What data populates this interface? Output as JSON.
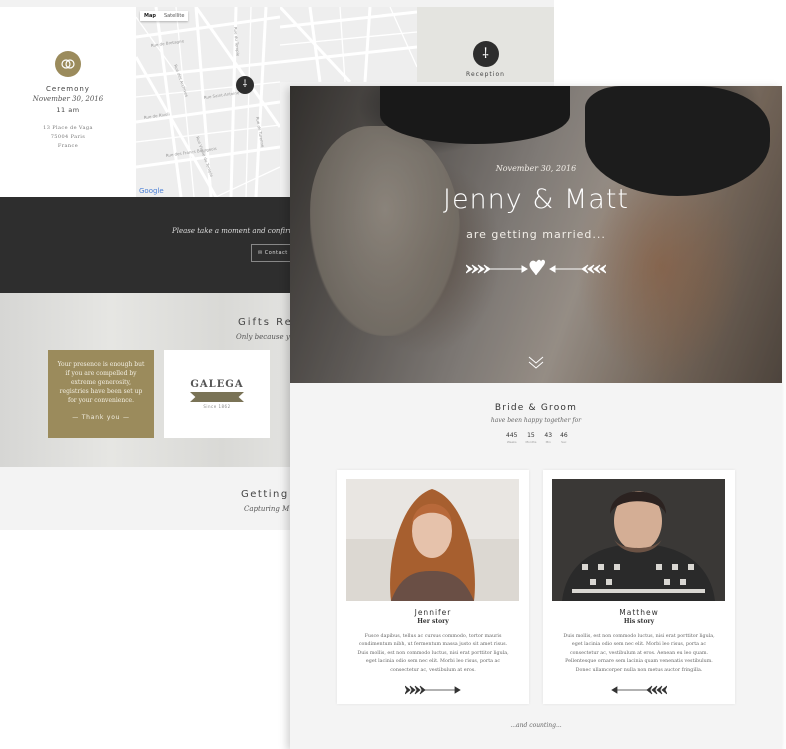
{
  "ceremony": {
    "icon": "wedding-rings-icon",
    "title": "Ceremony",
    "date": "November 30, 2016",
    "time": "11 am",
    "address": [
      "13 Place de Vaga",
      "75004 Paris",
      "France"
    ]
  },
  "map": {
    "tabs": [
      "Map",
      "Satellite"
    ],
    "active_tab": "Map",
    "attribution": "Google",
    "street_labels": [
      "Rue des Archives",
      "Rue de Rivoli",
      "Rue Saint-Antoine",
      "Rue du Temple",
      "Rue de Bretagne",
      "Rue Vieille du Temple",
      "Rue des Francs Bourgeois",
      "Rue de Turenne"
    ]
  },
  "reception": {
    "icon": "fork-knife-icon",
    "title": "Reception"
  },
  "rsvp": {
    "text": "Please take a moment and confirm",
    "button_label": "Contact"
  },
  "gifts": {
    "title": "Gifts Reg",
    "subtitle": "Only because yo",
    "card_text": "Your presence is enough but if you are compelled by extreme generosity, registries have been set up for your convenience.",
    "card_button": "— Thank you —",
    "partner_name": "GALEGA",
    "partner_tagline": "Since 1862"
  },
  "getting": {
    "title": "Getting R",
    "subtitle": "Capturing M"
  },
  "hero": {
    "date": "November 30, 2016",
    "names": "Jenny & Matt",
    "tagline": "are getting married...",
    "heart_icon": "hearts-arrow-icon",
    "scroll_icon": "chevron-down-icon"
  },
  "bride_groom": {
    "title": "Bride & Groom",
    "subtitle": "have been happy together for",
    "counter": [
      {
        "value": "445",
        "label": "Weeks"
      },
      {
        "value": "15",
        "label": "Months"
      },
      {
        "value": "43",
        "label": "Min"
      },
      {
        "value": "46",
        "label": "Sec"
      }
    ]
  },
  "bride": {
    "name": "Jennifer",
    "story_title": "Her story",
    "text": "Fusce dapibus, tellus ac cursus commodo, tortor mauris condimentum nibh, ut fermentum massa justo sit amet risus. Duis mollis, est non commodo luctus, nisi erat porttitor ligula, eget lacinia odio sem nec elit. Morbi leo risus, porta ac consectetur ac, vestibulum at eros."
  },
  "groom": {
    "name": "Matthew",
    "story_title": "His story",
    "text": "Duis mollis, est non commodo luctus, nisi erat porttitor ligula, eget lacinia odio sem nec elit. Morbi leo risus, porta ac consectetur ac, vestibulum at eros. Aenean eu leo quam. Pellentesque ornare sem lacinia quam venenatis vestibulum. Donec ullamcorper nulla non metus auctor fringilla."
  },
  "footer_text": "...and counting...",
  "colors": {
    "accent_gold": "#9b8b5c",
    "dark_band": "#2e2e2e",
    "background": "#f4f4f4"
  }
}
